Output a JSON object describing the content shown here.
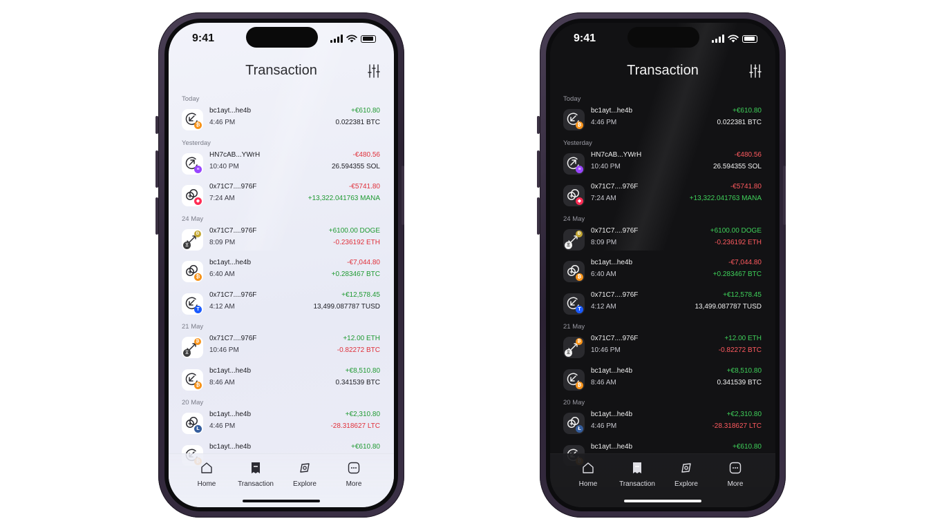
{
  "status": {
    "time": "9:41"
  },
  "header": {
    "title": "Transaction"
  },
  "colors": {
    "positive": "#1f9a32",
    "negative": "#e0303a",
    "btc": "#f7931a",
    "eth": "#3c3c3d",
    "sol": "#9945ff",
    "mana": "#ff2d55",
    "doge": "#c2a633",
    "tusd": "#1a5aff",
    "ltc": "#345d9d"
  },
  "sections": [
    {
      "label": "Today",
      "rows": [
        {
          "kind": "receive",
          "coin": "btc",
          "address": "bc1ayt...he4b",
          "time": "4:46 PM",
          "amount1": "+€610.80",
          "amount1_sign": "pos",
          "amount2": "0.022381 BTC",
          "amount2_sign": "neutral"
        }
      ]
    },
    {
      "label": "Yesterday",
      "rows": [
        {
          "kind": "send",
          "coin": "sol",
          "address": "HN7cAB...YWrH",
          "time": "10:40 PM",
          "amount1": "-€480.56",
          "amount1_sign": "neg",
          "amount2": "26.594355 SOL",
          "amount2_sign": "neutral"
        },
        {
          "kind": "swap",
          "coin": "mana",
          "address": "0x71C7....976F",
          "time": "7:24 AM",
          "amount1": "-€5741.80",
          "amount1_sign": "neg",
          "amount2": "+13,322.041763 MANA",
          "amount2_sign": "pos"
        }
      ]
    },
    {
      "label": "24 May",
      "rows": [
        {
          "kind": "exchange",
          "coin": "doge",
          "address": "0x71C7....976F",
          "time": "8:09 PM",
          "amount1": "+6100.00 DOGE",
          "amount1_sign": "pos",
          "amount2": "-0.236192 ETH",
          "amount2_sign": "neg"
        },
        {
          "kind": "swap",
          "coin": "btc",
          "address": "bc1ayt...he4b",
          "time": "6:40 AM",
          "amount1": "-€7,044.80",
          "amount1_sign": "neg",
          "amount2": "+0.283467 BTC",
          "amount2_sign": "pos"
        },
        {
          "kind": "receive",
          "coin": "tusd",
          "address": "0x71C7....976F",
          "time": "4:12 AM",
          "amount1": "+€12,578.45",
          "amount1_sign": "pos",
          "amount2": "13,499.087787 TUSD",
          "amount2_sign": "neutral"
        }
      ]
    },
    {
      "label": "21 May",
      "rows": [
        {
          "kind": "exchange",
          "coin": "btc",
          "address": "0x71C7....976F",
          "time": "10:46 PM",
          "amount1": "+12.00 ETH",
          "amount1_sign": "pos",
          "amount2": "-0.82272 BTC",
          "amount2_sign": "neg"
        },
        {
          "kind": "receive",
          "coin": "btc",
          "address": "bc1ayt...he4b",
          "time": "8:46 AM",
          "amount1": "+€8,510.80",
          "amount1_sign": "pos",
          "amount2": "0.341539 BTC",
          "amount2_sign": "neutral"
        }
      ]
    },
    {
      "label": "20 May",
      "rows": [
        {
          "kind": "swap",
          "coin": "ltc",
          "address": "bc1ayt...he4b",
          "time": "4:46 PM",
          "amount1": "+€2,310.80",
          "amount1_sign": "pos",
          "amount2": "-28.318627 LTC",
          "amount2_sign": "neg"
        },
        {
          "kind": "receive",
          "coin": "btc",
          "address": "bc1ayt...he4b",
          "time": "",
          "amount1": "+€610.80",
          "amount1_sign": "pos",
          "amount2": "",
          "amount2_sign": "neutral"
        }
      ]
    }
  ],
  "tabbar": [
    {
      "label": "Home",
      "icon": "home-icon",
      "active": false
    },
    {
      "label": "Transaction",
      "icon": "receipt-icon",
      "active": true
    },
    {
      "label": "Explore",
      "icon": "compass-icon",
      "active": false
    },
    {
      "label": "More",
      "icon": "more-icon",
      "active": false
    }
  ]
}
